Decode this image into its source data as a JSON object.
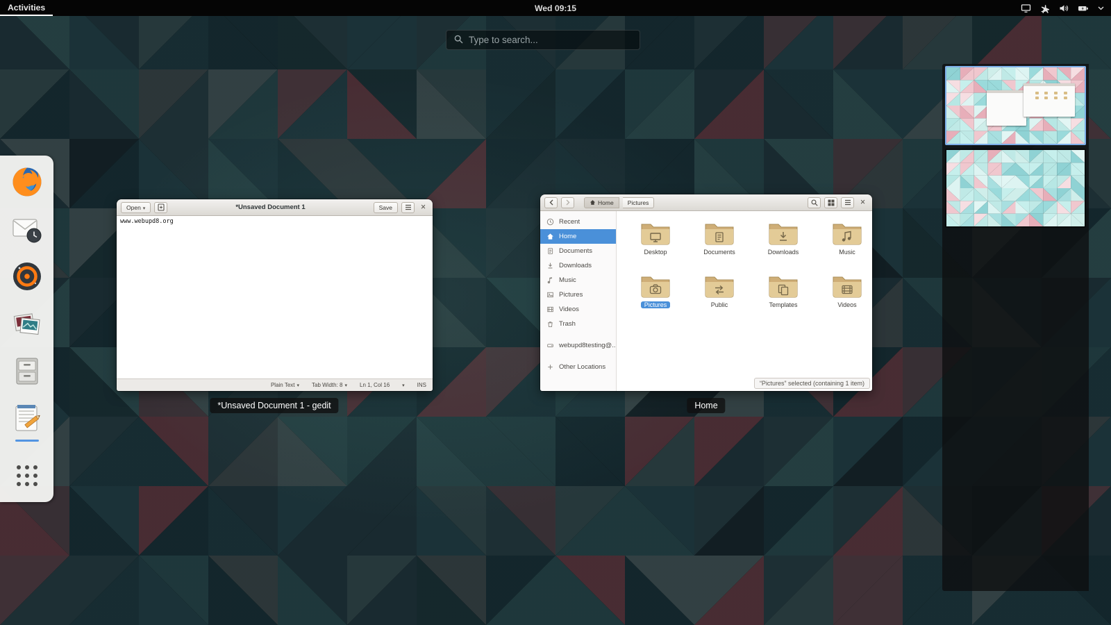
{
  "topbar": {
    "activities_label": "Activities",
    "clock": "Wed 09:15",
    "status_icon_names": [
      "screen-icon",
      "airplane-mode-icon",
      "volume-icon",
      "battery-icon",
      "chevron-down-icon"
    ]
  },
  "search": {
    "placeholder": "Type to search..."
  },
  "dash": {
    "apps": [
      {
        "id": "firefox"
      },
      {
        "id": "evolution-mail"
      },
      {
        "id": "rhythmbox"
      },
      {
        "id": "photos"
      },
      {
        "id": "files"
      },
      {
        "id": "gedit",
        "running": true
      },
      {
        "id": "show-applications"
      }
    ]
  },
  "gedit": {
    "open_label": "Open",
    "title": "*Unsaved Document 1",
    "save_label": "Save",
    "body_text": "www.webupd8.org",
    "status": {
      "language": "Plain Text",
      "tab_width": "Tab Width: 8",
      "cursor_pos": "Ln 1, Col 16",
      "overwrite_mode": "INS"
    },
    "overview_label": "*Unsaved Document 1 - gedit"
  },
  "files": {
    "path": {
      "home": "Home",
      "child": "Pictures"
    },
    "sidebar": [
      {
        "label": "Recent"
      },
      {
        "label": "Home",
        "selected": true
      },
      {
        "label": "Documents"
      },
      {
        "label": "Downloads"
      },
      {
        "label": "Music"
      },
      {
        "label": "Pictures"
      },
      {
        "label": "Videos"
      },
      {
        "label": "Trash"
      },
      {
        "label": "webupd8testing@..."
      },
      {
        "label": "Other Locations"
      }
    ],
    "folders": [
      {
        "label": "Desktop"
      },
      {
        "label": "Documents"
      },
      {
        "label": "Downloads"
      },
      {
        "label": "Music"
      },
      {
        "label": "Pictures",
        "selected": true
      },
      {
        "label": "Public"
      },
      {
        "label": "Templates"
      },
      {
        "label": "Videos"
      }
    ],
    "status_text": "“Pictures” selected (containing 1 item)",
    "overview_label": "Home"
  },
  "workspaces": {
    "count": 2,
    "active_index": 0
  },
  "colors": {
    "selection_blue": "#4a90d9",
    "panel_black": "#050505",
    "dash_bg": "#f3f3f1",
    "wallpaper_base": "#2a4e55",
    "folder_tan": "#e3cb97"
  }
}
